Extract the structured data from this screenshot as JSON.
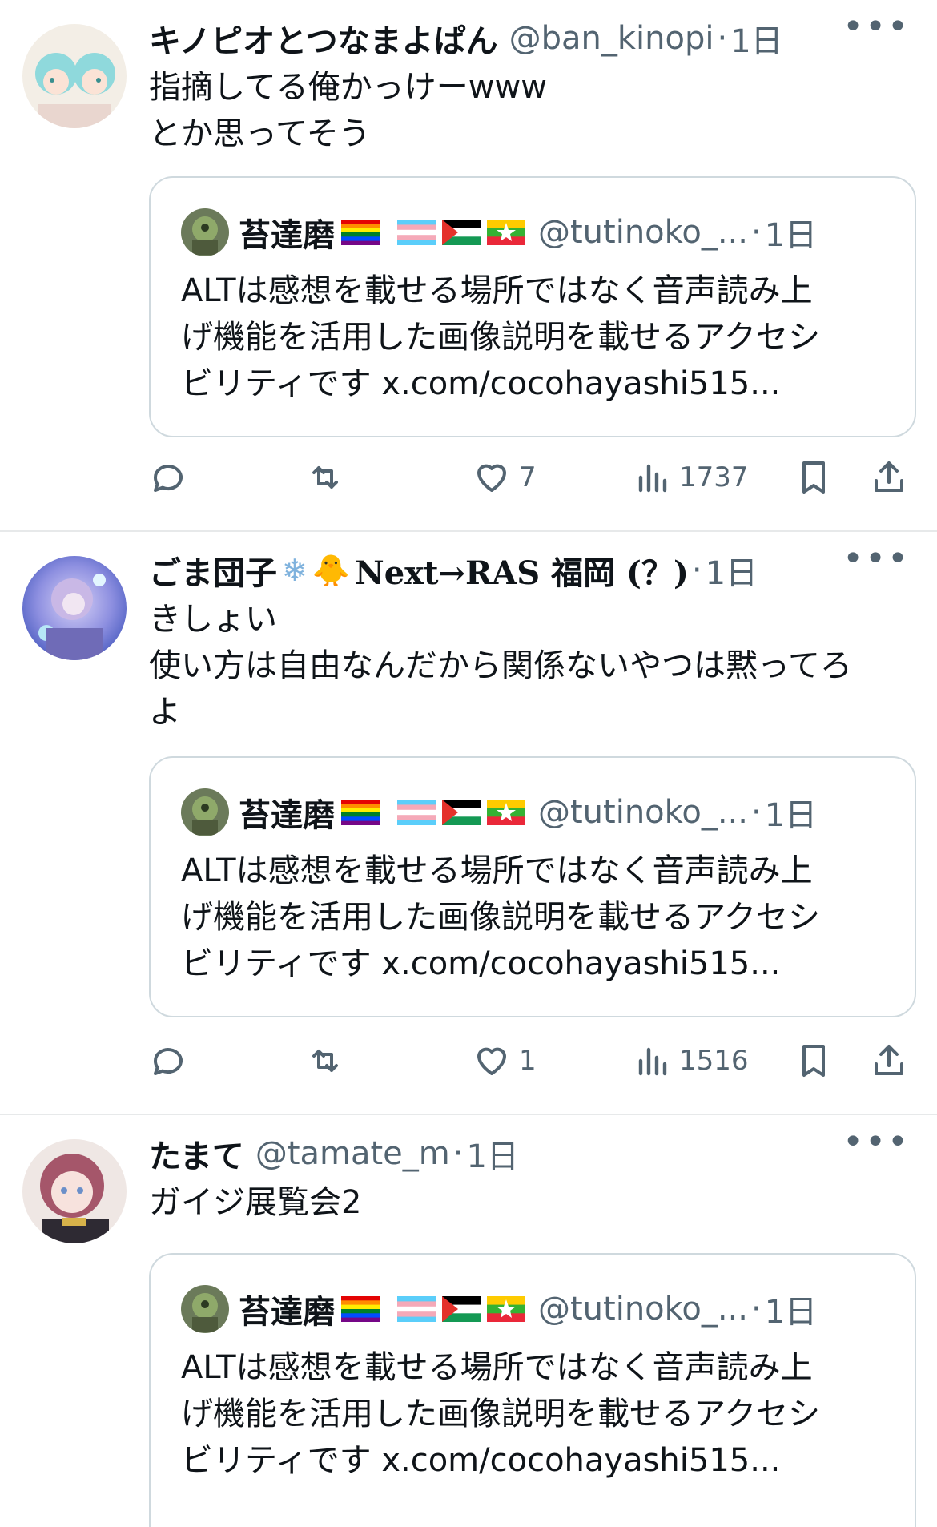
{
  "tweets": [
    {
      "name": "キノピオとつなまよぱん",
      "handle": "@ban_kinopi",
      "time": "1日",
      "text": "指摘してる俺かっけーwww\nとか思ってそう",
      "likes": "7",
      "views": "1737",
      "quote": {
        "name": "苔達磨",
        "handle": "@tutinoko_...",
        "time": "1日",
        "text": "ALTは感想を載せる場所ではなく音声読み上\nげ機能を活用した画像説明を載せるアクセシ\nビリティです x.com/cocohayashi515..."
      }
    },
    {
      "name": "ごま団子",
      "name_suffix": "Next→RAS 福岡 (？)",
      "time": "1日",
      "text": "きしょい\n使い方は自由なんだから関係ないやつは黙ってろ\nよ",
      "likes": "1",
      "views": "1516",
      "quote": {
        "name": "苔達磨",
        "handle": "@tutinoko_...",
        "time": "1日",
        "text": "ALTは感想を載せる場所ではなく音声読み上\nげ機能を活用した画像説明を載せるアクセシ\nビリティです x.com/cocohayashi515..."
      }
    },
    {
      "name": "たまて",
      "handle": "@tamate_m",
      "time": "1日",
      "text": "ガイジ展覧会2",
      "quote": {
        "name": "苔達磨",
        "handle": "@tutinoko_...",
        "time": "1日",
        "text": "ALTは感想を載せる場所ではなく音声読み上\nげ機能を活用した画像説明を載せるアクセシ\nビリティです x.com/cocohayashi515..."
      }
    }
  ],
  "symbols": {
    "dot": "·",
    "more": "•••",
    "snowflake": "❄",
    "duck": "🐥"
  },
  "colors": {
    "text": "#0f1419",
    "secondary": "#536471",
    "border": "#e7e9ea",
    "quote_border": "#cfd9de"
  },
  "icons": [
    "reply-icon",
    "retweet-icon",
    "like-icon",
    "views-icon",
    "bookmark-icon",
    "share-icon",
    "more-icon"
  ]
}
